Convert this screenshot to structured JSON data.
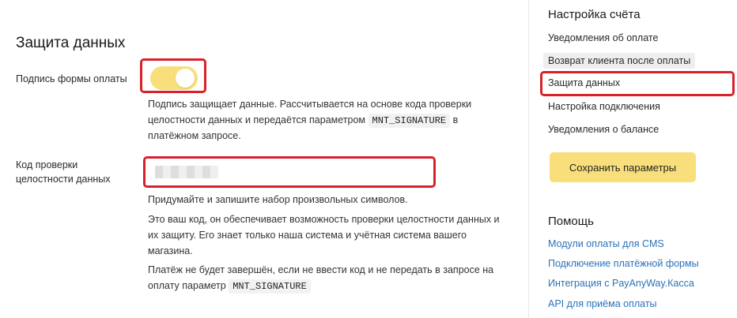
{
  "main": {
    "section_title": "Защита данных",
    "signature": {
      "label": "Подпись формы оплаты",
      "toggle_on": true,
      "help_before": "Подпись защищает данные. Рассчитывается на основе кода проверки целостности данных и передаётся параметром ",
      "help_code": "MNT_SIGNATURE",
      "help_after": " в платёжном запросе."
    },
    "integrity_code": {
      "label": "Код проверки целостности данных",
      "value": "",
      "help_p1": "Придумайте и запишите набор произвольных символов.",
      "help_p2": "Это ваш код, он обеспечивает возможность проверки целостности данных и их защиту. Его знает только наша система и учётная система вашего магазина.",
      "help_p3_before": "Платёж не будет завершён, если не ввести код и не передать в запросе на оплату параметр ",
      "help_p3_code": "MNT_SIGNATURE"
    }
  },
  "sidebar": {
    "settings_title": "Настройка счёта",
    "items": [
      {
        "label": "Уведомления об оплате"
      },
      {
        "label": "Возврат клиента после оплаты"
      },
      {
        "label": "Защита данных"
      },
      {
        "label": "Настройка подключения"
      },
      {
        "label": "Уведомления о балансе"
      }
    ],
    "save_label": "Сохранить параметры",
    "help_title": "Помощь",
    "help_links": [
      {
        "label": "Модули оплаты для CMS"
      },
      {
        "label": "Подключение платёжной формы"
      },
      {
        "label": "Интеграция с PayAnyWay.Касса"
      },
      {
        "label": "API для приёма оплаты"
      }
    ]
  },
  "colors": {
    "accent_yellow": "#f9df7c",
    "highlight_red": "#d8222b",
    "link_blue": "#2a72b8"
  }
}
